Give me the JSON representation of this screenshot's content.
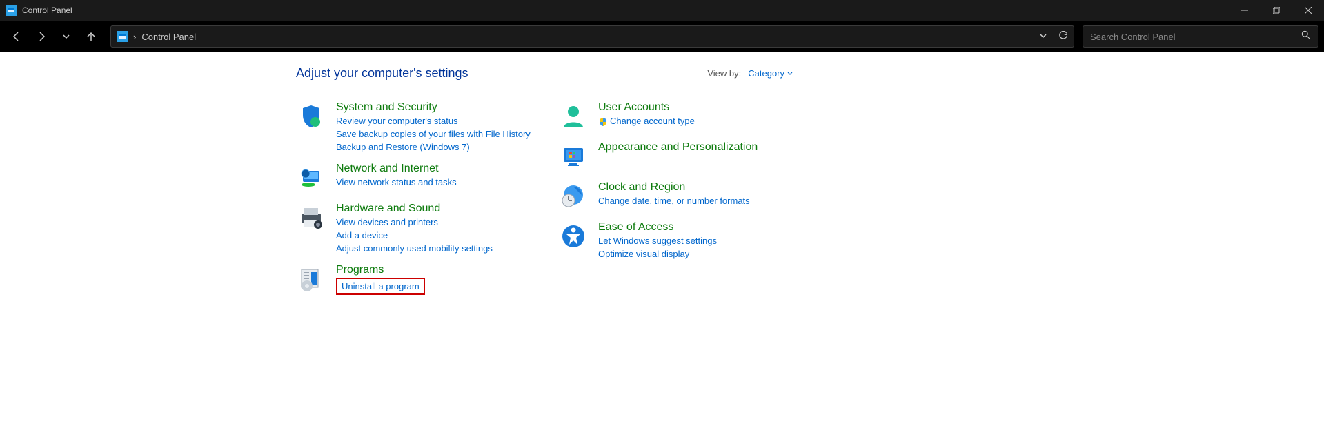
{
  "titlebar": {
    "title": "Control Panel"
  },
  "navbar": {
    "breadcrumb_sep": "›",
    "breadcrumb": "Control Panel",
    "search_placeholder": "Search Control Panel"
  },
  "page": {
    "heading": "Adjust your computer's settings",
    "viewby_label": "View by:",
    "viewby_value": "Category"
  },
  "categories_left": [
    {
      "icon": "shield-icon",
      "title": "System and Security",
      "links": [
        {
          "text": "Review your computer's status"
        },
        {
          "text": "Save backup copies of your files with File History"
        },
        {
          "text": "Backup and Restore (Windows 7)"
        }
      ]
    },
    {
      "icon": "globe-icon",
      "title": "Network and Internet",
      "links": [
        {
          "text": "View network status and tasks"
        }
      ]
    },
    {
      "icon": "printer-icon",
      "title": "Hardware and Sound",
      "links": [
        {
          "text": "View devices and printers"
        },
        {
          "text": "Add a device"
        },
        {
          "text": "Adjust commonly used mobility settings"
        }
      ]
    },
    {
      "icon": "programs-icon",
      "title": "Programs",
      "links": [
        {
          "text": "Uninstall a program",
          "highlighted": true
        }
      ]
    }
  ],
  "categories_right": [
    {
      "icon": "user-icon",
      "title": "User Accounts",
      "links": [
        {
          "text": "Change account type",
          "shield": true
        }
      ]
    },
    {
      "icon": "monitor-icon",
      "title": "Appearance and Personalization",
      "links": []
    },
    {
      "icon": "clock-icon",
      "title": "Clock and Region",
      "links": [
        {
          "text": "Change date, time, or number formats"
        }
      ]
    },
    {
      "icon": "ease-icon",
      "title": "Ease of Access",
      "links": [
        {
          "text": "Let Windows suggest settings"
        },
        {
          "text": "Optimize visual display"
        }
      ]
    }
  ]
}
